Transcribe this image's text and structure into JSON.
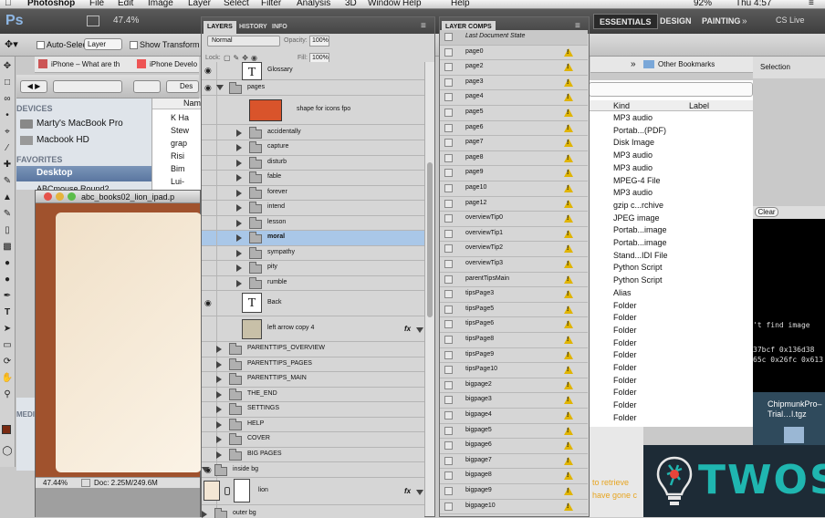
{
  "menubar": {
    "app": "Photoshop",
    "items": [
      "File",
      "Edit",
      "Image",
      "Layer",
      "Select",
      "Filter",
      "Analysis",
      "3D",
      "Window",
      "Help"
    ],
    "battery": "92%",
    "clock": "Thu 4:57"
  },
  "appbar": {
    "logo": "Ps",
    "zoom": "47.4%",
    "workspaces": [
      "ESSENTIALS",
      "DESIGN",
      "PAINTING"
    ],
    "cslive": "CS Live"
  },
  "options": {
    "auto_select": "Auto-Select:",
    "auto_select_value": "Layer",
    "transform": "Show Transform Con"
  },
  "browser": {
    "bookmarks": [
      "iPhone – What are th",
      "iPhone Develo"
    ],
    "other_bookmarks": "Other Bookmarks",
    "selection": "Selection"
  },
  "finder": {
    "devices_header": "DEVICES",
    "devices": [
      "Marty's MacBook Pro",
      "Macbook HD"
    ],
    "favorites_header": "FAVORITES",
    "favorites": [
      "Desktop",
      "ABCmouse Round2"
    ],
    "media_header": "MEDIA",
    "path": "Des",
    "col_name": "Nam",
    "names": [
      "K Ha",
      "Stew",
      "grap",
      "Risi",
      "Bim",
      "Lui-"
    ]
  },
  "table": {
    "headers": [
      "Kind",
      "Label"
    ],
    "kinds": [
      "MP3 audio",
      "Portab...(PDF)",
      "Disk Image",
      "MP3 audio",
      "MP3 audio",
      "MPEG-4 File",
      "MP3 audio",
      "gzip c...rchive",
      "JPEG image",
      "Portab...image",
      "Portab...image",
      "Stand...IDI File",
      "Python Script",
      "Python Script",
      "Alias",
      "Folder",
      "Folder",
      "Folder",
      "Folder",
      "Folder",
      "Folder",
      "Folder",
      "Folder",
      "Folder",
      "Folder"
    ],
    "clear": "Clear"
  },
  "terminal": {
    "lines": [
      "'t find image",
      "37bcf 0x136d38",
      "65c 0x26fc 0x613"
    ]
  },
  "desktop": {
    "file": "ChipmunkPro–Trial…l.tgz",
    "retrieve": "to retrieve",
    "gone": "have gone c"
  },
  "document": {
    "title": "abc_books02_lion_ipad.p",
    "zoom": "47.44%",
    "status": "Doc: 2.25M/249.6M"
  },
  "layers": {
    "tabs": [
      "LAYERS",
      "HISTORY",
      "INFO"
    ],
    "blend": "Normal",
    "opacity_label": "Opacity:",
    "opacity": "100%",
    "lock_label": "Lock:",
    "fill_label": "Fill:",
    "fill": "100%",
    "rows": [
      "Glossary",
      "pages",
      "shape for icons fpo",
      "accidentally",
      "capture",
      "disturb",
      "fable",
      "forever",
      "intend",
      "lesson",
      "moral",
      "sympathy",
      "pity",
      "rumble",
      "Back",
      "left arrow copy 4",
      "PARENTTIPS_OVERVIEW",
      "PARENTTIPS_PAGES",
      "PARENTTIPS_MAIN",
      "THE_END",
      "SETTINGS",
      "HELP",
      "COVER",
      "BIG PAGES",
      "inside bg",
      "lion",
      "outer bg"
    ],
    "fx": "fx",
    "text_icon": "T"
  },
  "comps": {
    "tab": "LAYER COMPS",
    "items": [
      "Last Document State",
      "page0",
      "page2",
      "page3",
      "page4",
      "page5",
      "page6",
      "page7",
      "page8",
      "page9",
      "page10",
      "page12",
      "overviewTip0",
      "overviewTip1",
      "overviewTip2",
      "overviewTip3",
      "parentTipsMain",
      "tipsPage3",
      "tipsPage5",
      "tipsPage6",
      "tipsPage8",
      "tipsPage9",
      "tipsPage10",
      "bigpage2",
      "bigpage3",
      "bigpage4",
      "bigpage5",
      "bigpage6",
      "bigpage7",
      "bigpage8",
      "bigpage9",
      "bigpage10"
    ]
  },
  "watermark": {
    "text": "TWOS"
  },
  "colors": {
    "layer_orange": "#d9542b",
    "doc_brown": "#a0522d",
    "selected_row": "#a9c7e8",
    "twos_bg": "#1d2b36",
    "twos_accent": "#1fb6b0"
  }
}
